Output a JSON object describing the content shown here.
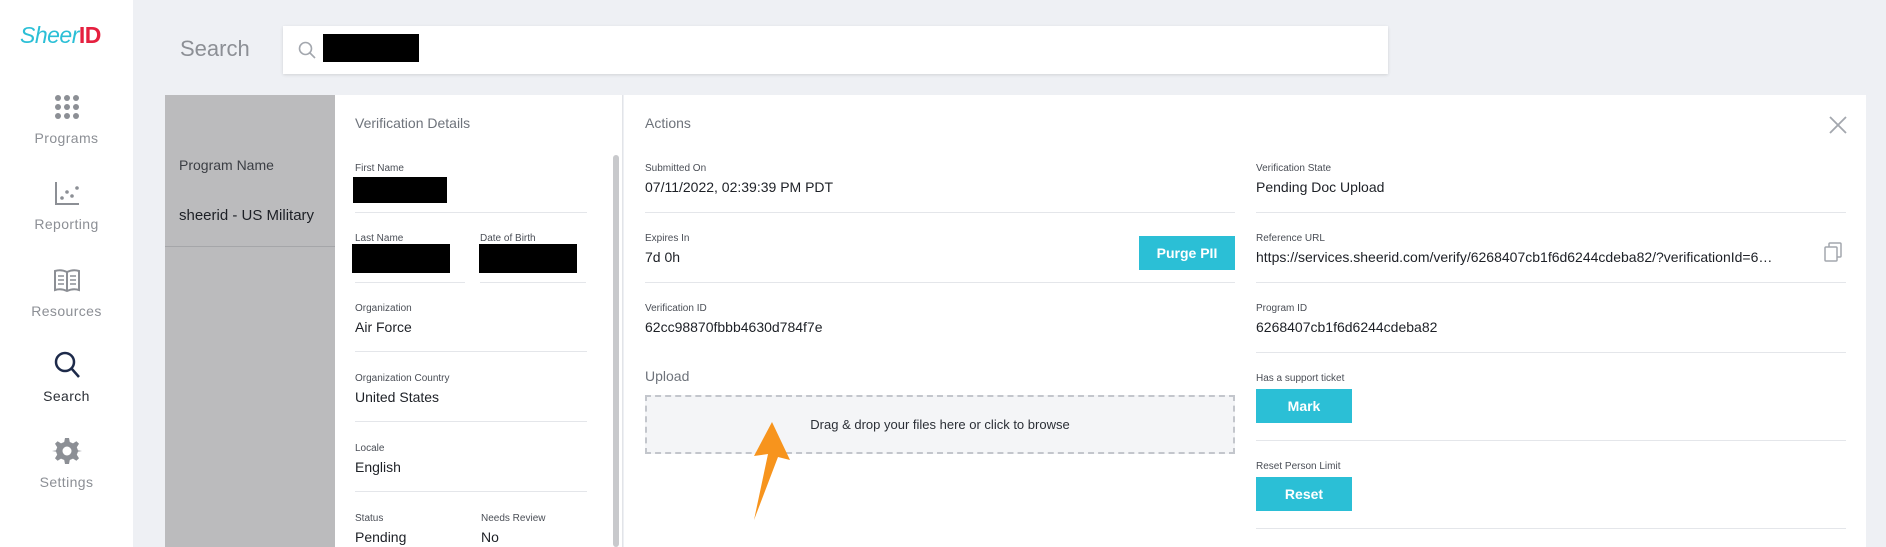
{
  "brand": {
    "logo_part1": "Sheer",
    "logo_part2": "ID",
    "accent": "#2bbfd6",
    "logo_red": "#e5203f"
  },
  "sidebar": {
    "items": [
      {
        "label": "Programs",
        "icon": "grid-icon"
      },
      {
        "label": "Reporting",
        "icon": "chart-icon"
      },
      {
        "label": "Resources",
        "icon": "book-icon"
      },
      {
        "label": "Search",
        "icon": "search-icon",
        "active": true
      },
      {
        "label": "Settings",
        "icon": "gear-icon"
      }
    ]
  },
  "search": {
    "label": "Search"
  },
  "program": {
    "header": "Program Name",
    "value": "sheerid - US Military"
  },
  "details": {
    "title": "Verification Details",
    "first_name_label": "First Name",
    "last_name_label": "Last Name",
    "dob_label": "Date of Birth",
    "organization_label": "Organization",
    "organization_value": "Air Force",
    "org_country_label": "Organization Country",
    "org_country_value": "United States",
    "locale_label": "Locale",
    "locale_value": "English",
    "status_label": "Status",
    "status_value": "Pending",
    "needs_review_label": "Needs Review",
    "needs_review_value": "No"
  },
  "actions": {
    "title": "Actions",
    "submitted_label": "Submitted On",
    "submitted_value": "07/11/2022, 02:39:39 PM PDT",
    "expires_label": "Expires In",
    "expires_value": "7d 0h",
    "purge_button": "Purge PII",
    "verification_id_label": "Verification ID",
    "verification_id_value": "62cc98870fbbb4630d784f7e",
    "upload_label": "Upload",
    "upload_text": "Drag & drop your files here or click to browse",
    "state_label": "Verification State",
    "state_value": "Pending Doc Upload",
    "reference_label": "Reference URL",
    "reference_value": "https://services.sheerid.com/verify/6268407cb1f6d6244cdeba82/?verificationId=6…",
    "program_id_label": "Program ID",
    "program_id_value": "6268407cb1f6d6244cdeba82",
    "support_ticket_label": "Has a support ticket",
    "mark_button": "Mark",
    "reset_limit_label": "Reset Person Limit",
    "reset_button": "Reset"
  },
  "annotation": {
    "arrow_color": "#f7941d"
  }
}
